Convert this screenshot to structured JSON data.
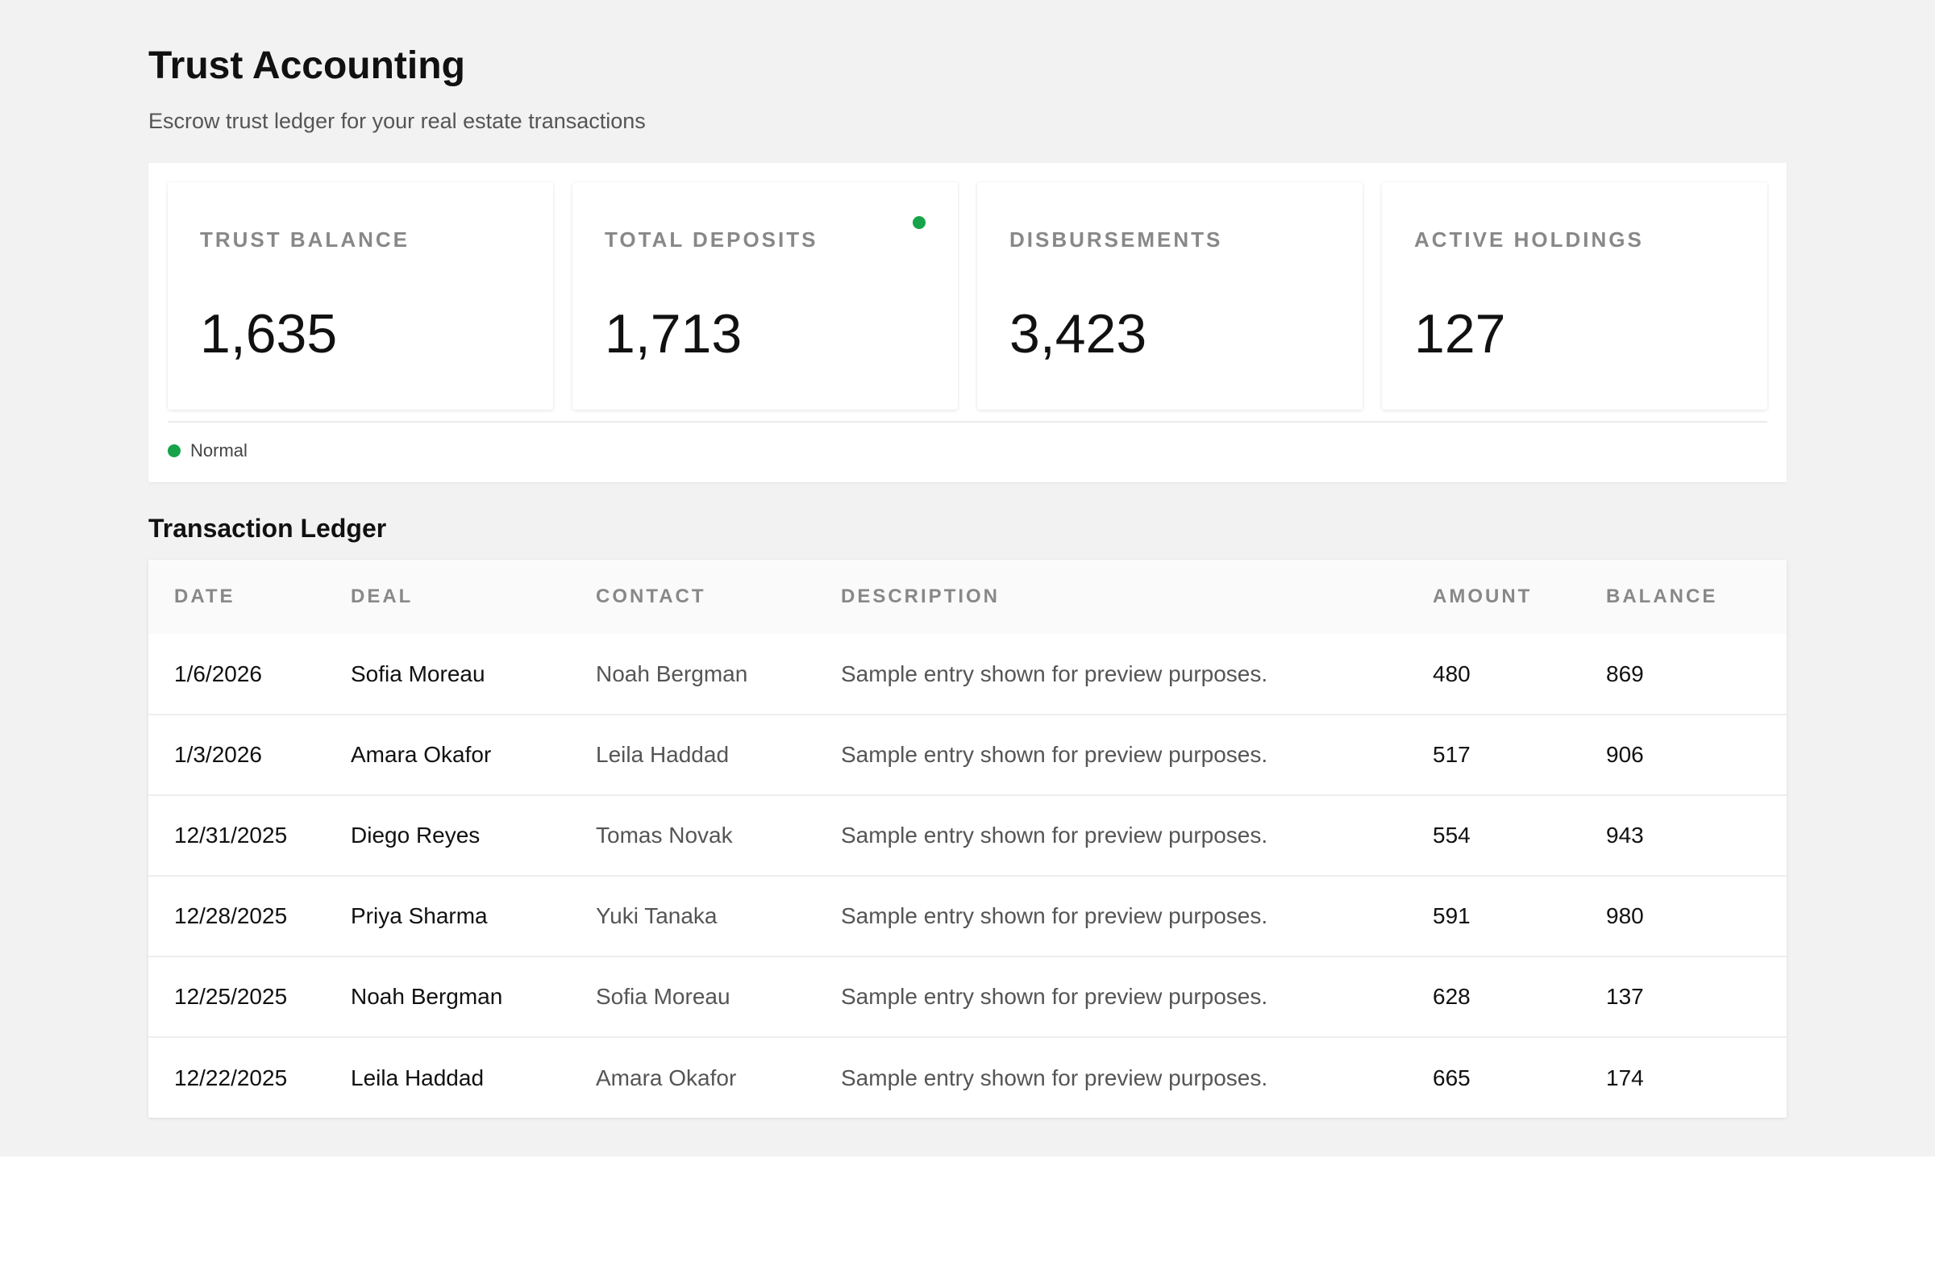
{
  "header": {
    "title": "Trust Accounting",
    "subtitle": "Escrow trust ledger for your real estate transactions"
  },
  "stats": {
    "cards": [
      {
        "label": "TRUST BALANCE",
        "value": "1,635",
        "indicator": false
      },
      {
        "label": "TOTAL DEPOSITS",
        "value": "1,713",
        "indicator": true
      },
      {
        "label": "DISBURSEMENTS",
        "value": "3,423",
        "indicator": false
      },
      {
        "label": "ACTIVE HOLDINGS",
        "value": "127",
        "indicator": false
      }
    ],
    "legend": {
      "label": "Normal",
      "color": "#16a34a"
    }
  },
  "ledger": {
    "title": "Transaction Ledger",
    "columns": [
      "DATE",
      "DEAL",
      "CONTACT",
      "DESCRIPTION",
      "AMOUNT",
      "BALANCE"
    ],
    "rows": [
      {
        "date": "1/6/2026",
        "deal": "Sofia Moreau",
        "contact": "Noah Bergman",
        "description": "Sample entry shown for preview purposes.",
        "amount": "480",
        "balance": "869"
      },
      {
        "date": "1/3/2026",
        "deal": "Amara Okafor",
        "contact": "Leila Haddad",
        "description": "Sample entry shown for preview purposes.",
        "amount": "517",
        "balance": "906"
      },
      {
        "date": "12/31/2025",
        "deal": "Diego Reyes",
        "contact": "Tomas Novak",
        "description": "Sample entry shown for preview purposes.",
        "amount": "554",
        "balance": "943"
      },
      {
        "date": "12/28/2025",
        "deal": "Priya Sharma",
        "contact": "Yuki Tanaka",
        "description": "Sample entry shown for preview purposes.",
        "amount": "591",
        "balance": "980"
      },
      {
        "date": "12/25/2025",
        "deal": "Noah Bergman",
        "contact": "Sofia Moreau",
        "description": "Sample entry shown for preview purposes.",
        "amount": "628",
        "balance": "137"
      },
      {
        "date": "12/22/2025",
        "deal": "Leila Haddad",
        "contact": "Amara Okafor",
        "description": "Sample entry shown for preview purposes.",
        "amount": "665",
        "balance": "174"
      }
    ]
  },
  "colors": {
    "background": "#f2f2f2",
    "status_green": "#16a34a"
  }
}
